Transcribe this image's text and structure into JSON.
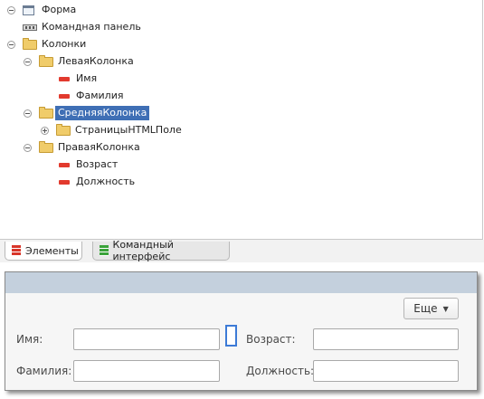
{
  "tree": {
    "items": [
      {
        "label": "Форма",
        "icon": "form-icon"
      },
      {
        "label": "Командная панель",
        "icon": "command-panel-icon"
      },
      {
        "label": "Колонки",
        "icon": "folder-icon",
        "expanded": true
      },
      {
        "label": "ЛеваяКолонка",
        "icon": "folder-icon",
        "expanded": true
      },
      {
        "label": "Имя",
        "icon": "field-icon"
      },
      {
        "label": "Фамилия",
        "icon": "field-icon"
      },
      {
        "label": "СредняяКолонка",
        "icon": "folder-icon",
        "expanded": true,
        "selected": true
      },
      {
        "label": "СтраницыHTMLПоле",
        "icon": "folder-icon",
        "expanded": false
      },
      {
        "label": "ПраваяКолонка",
        "icon": "folder-icon",
        "expanded": true
      },
      {
        "label": "Возраст",
        "icon": "field-icon"
      },
      {
        "label": "Должность",
        "icon": "field-icon"
      }
    ]
  },
  "tabs": [
    {
      "label": "Элементы",
      "icon": "elements-icon",
      "active": true
    },
    {
      "label": "Командный интерфейс",
      "icon": "command-interface-icon",
      "active": false
    }
  ],
  "preview": {
    "more_button": "Еще",
    "fields": {
      "name_label": "Имя:",
      "surname_label": "Фамилия:",
      "age_label": "Возраст:",
      "position_label": "Должность:"
    }
  },
  "colors": {
    "selection": "#3f6fb5",
    "header": "#c4d0dd",
    "focus": "#3c7ad6"
  }
}
